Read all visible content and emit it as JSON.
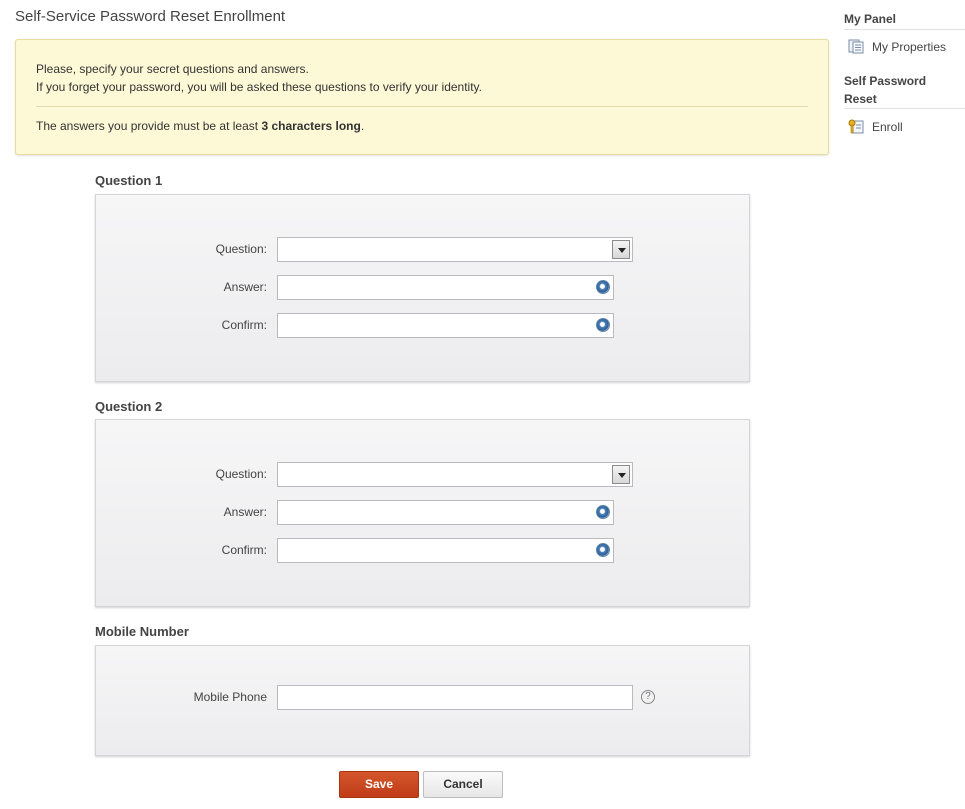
{
  "page": {
    "title": "Self-Service Password Reset Enrollment"
  },
  "notice": {
    "line1": "Please, specify your secret questions and answers.",
    "line2": "If you forget your password, you will be asked these questions to verify your identity.",
    "line3_prefix": "The answers you provide must be at least ",
    "line3_bold": "3 characters long",
    "line3_suffix": "."
  },
  "question1": {
    "title": "Question 1",
    "question_label": "Question:",
    "answer_label": "Answer:",
    "confirm_label": "Confirm:"
  },
  "question2": {
    "title": "Question 2",
    "question_label": "Question:",
    "answer_label": "Answer:",
    "confirm_label": "Confirm:"
  },
  "mobile": {
    "title": "Mobile Number",
    "phone_label": "Mobile Phone",
    "help_glyph": "?"
  },
  "buttons": {
    "save": "Save",
    "cancel": "Cancel"
  },
  "sidebar": {
    "my_panel": "My Panel",
    "my_properties": "My Properties",
    "spr_line1": "Self Password",
    "spr_line2": "Reset",
    "enroll": "Enroll"
  },
  "colors": {
    "save_button": "#c8461e",
    "notice_bg": "#fdf8d6"
  },
  "icons": [
    "chevron-down-icon",
    "eye-icon",
    "help-icon",
    "properties-icon",
    "key-icon"
  ]
}
